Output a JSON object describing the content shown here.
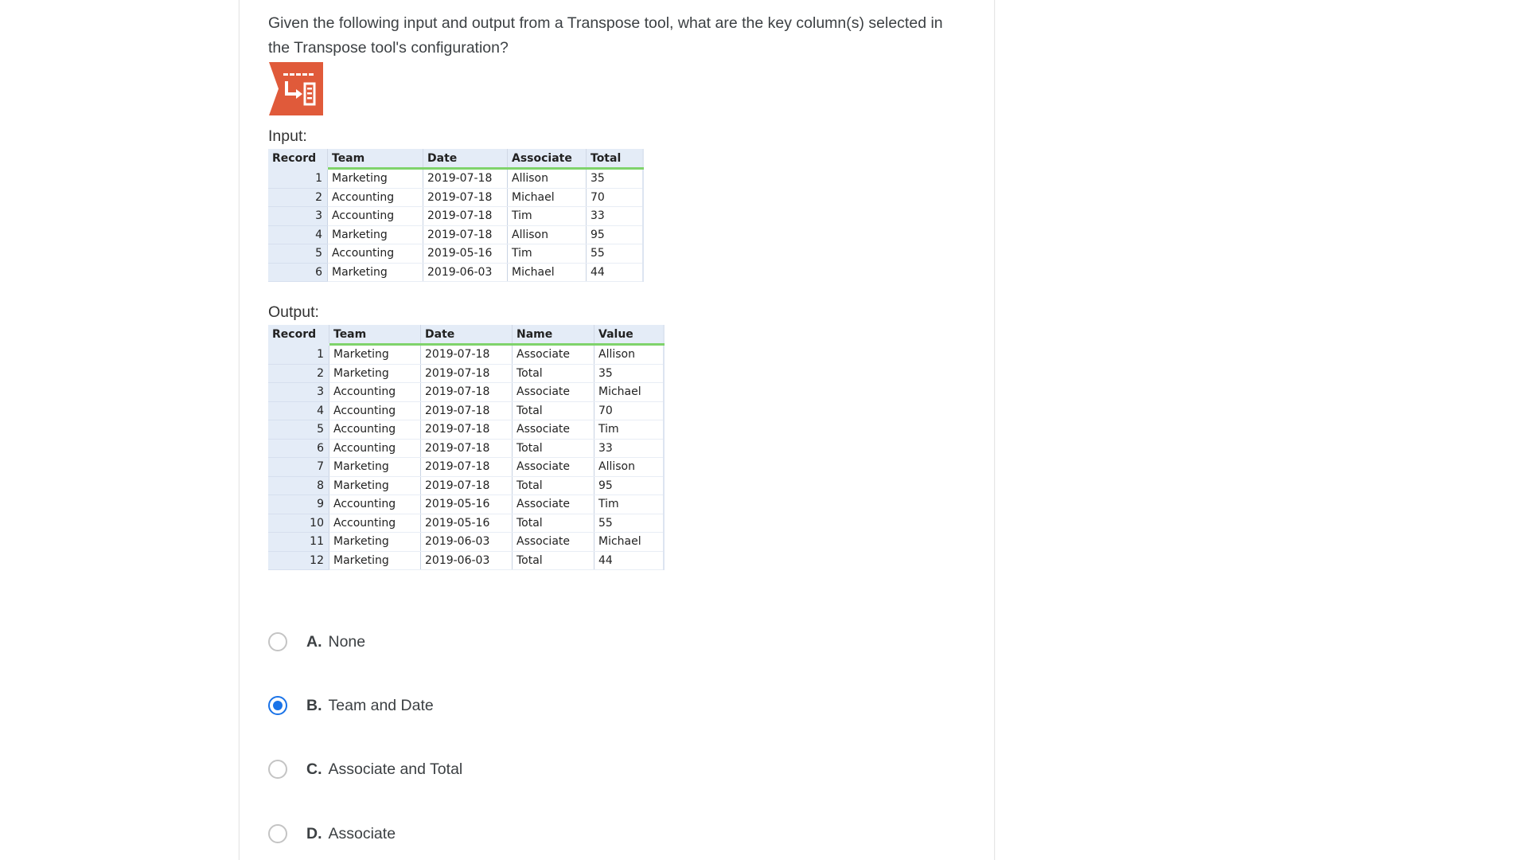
{
  "question": {
    "text": "Given the following input and output from a Transpose tool, what are the key column(s) selected in the Transpose tool's configuration?",
    "icon": "transpose-tool-icon",
    "icon_color": "#e05a3a"
  },
  "input": {
    "label": "Input:",
    "columns": [
      "Record",
      "Team",
      "Date",
      "Associate",
      "Total"
    ],
    "rows": [
      [
        "1",
        "Marketing",
        "2019-07-18",
        "Allison",
        "35"
      ],
      [
        "2",
        "Accounting",
        "2019-07-18",
        "Michael",
        "70"
      ],
      [
        "3",
        "Accounting",
        "2019-07-18",
        "Tim",
        "33"
      ],
      [
        "4",
        "Marketing",
        "2019-07-18",
        "Allison",
        "95"
      ],
      [
        "5",
        "Accounting",
        "2019-05-16",
        "Tim",
        "55"
      ],
      [
        "6",
        "Marketing",
        "2019-06-03",
        "Michael",
        "44"
      ]
    ]
  },
  "output": {
    "label": "Output:",
    "columns": [
      "Record",
      "Team",
      "Date",
      "Name",
      "Value"
    ],
    "rows": [
      [
        "1",
        "Marketing",
        "2019-07-18",
        "Associate",
        "Allison"
      ],
      [
        "2",
        "Marketing",
        "2019-07-18",
        "Total",
        "35"
      ],
      [
        "3",
        "Accounting",
        "2019-07-18",
        "Associate",
        "Michael"
      ],
      [
        "4",
        "Accounting",
        "2019-07-18",
        "Total",
        "70"
      ],
      [
        "5",
        "Accounting",
        "2019-07-18",
        "Associate",
        "Tim"
      ],
      [
        "6",
        "Accounting",
        "2019-07-18",
        "Total",
        "33"
      ],
      [
        "7",
        "Marketing",
        "2019-07-18",
        "Associate",
        "Allison"
      ],
      [
        "8",
        "Marketing",
        "2019-07-18",
        "Total",
        "95"
      ],
      [
        "9",
        "Accounting",
        "2019-05-16",
        "Associate",
        "Tim"
      ],
      [
        "10",
        "Accounting",
        "2019-05-16",
        "Total",
        "55"
      ],
      [
        "11",
        "Marketing",
        "2019-06-03",
        "Associate",
        "Michael"
      ],
      [
        "12",
        "Marketing",
        "2019-06-03",
        "Total",
        "44"
      ]
    ]
  },
  "options": [
    {
      "letter": "A.",
      "text": "None",
      "selected": false
    },
    {
      "letter": "B.",
      "text": "Team and Date",
      "selected": true
    },
    {
      "letter": "C.",
      "text": "Associate and Total",
      "selected": false
    },
    {
      "letter": "D.",
      "text": "Associate",
      "selected": false
    }
  ],
  "colors": {
    "accent": "#1a73e8",
    "header_bg": "#e4ecf7",
    "header_underline": "#7fd36b"
  }
}
